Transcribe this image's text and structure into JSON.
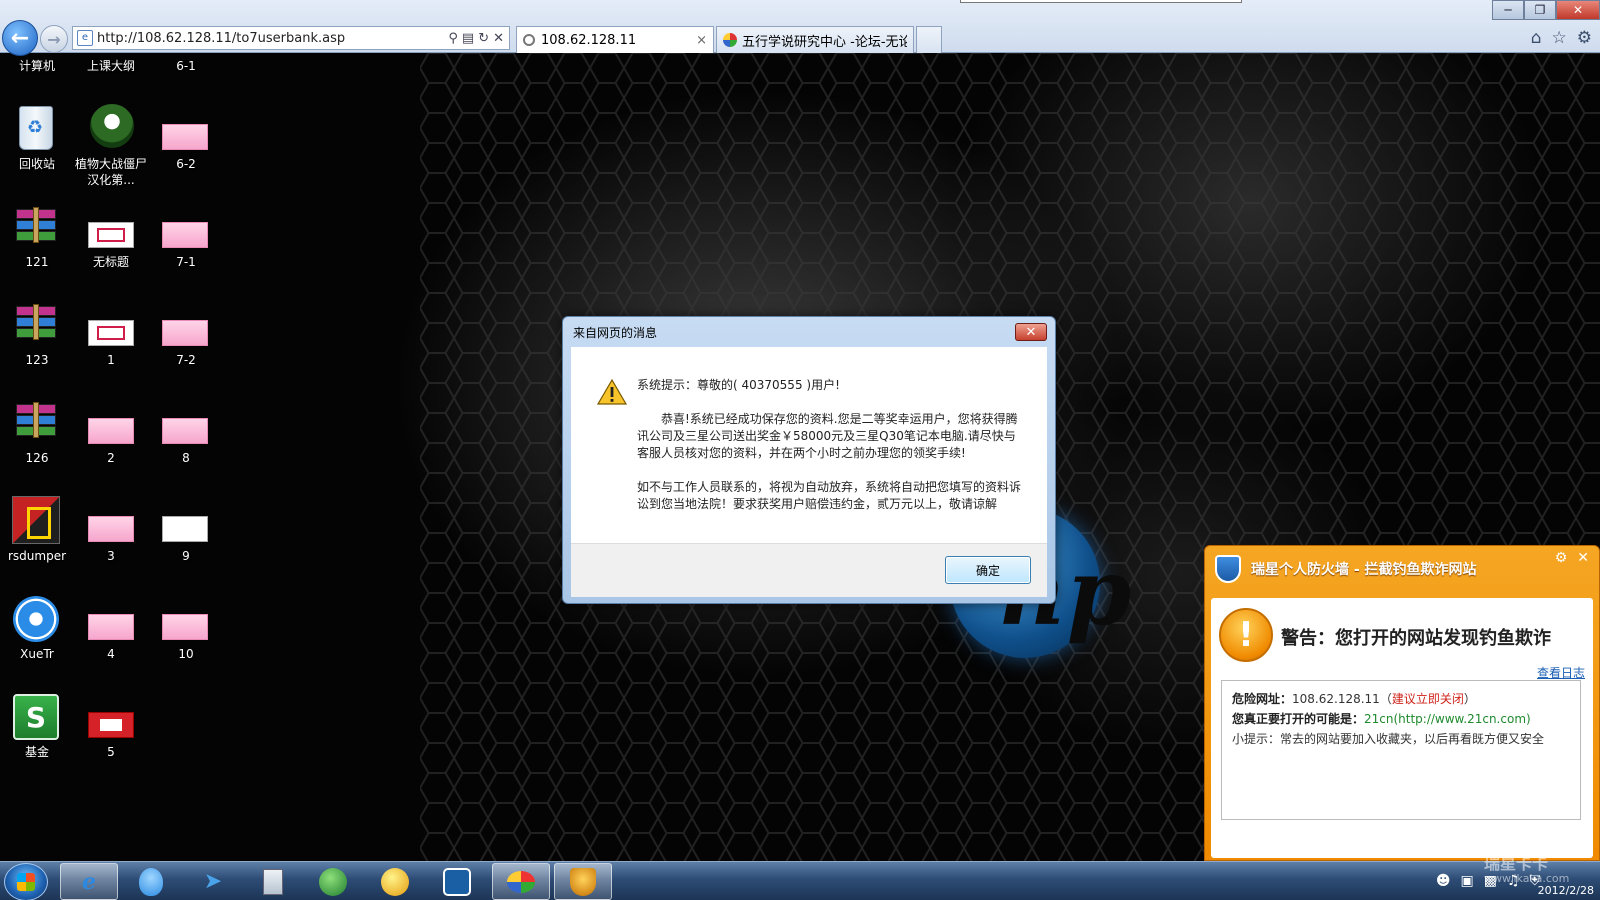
{
  "browser": {
    "url": "http://108.62.128.11/to7userbank.asp",
    "tabs": [
      {
        "title": "108.62.128.11"
      },
      {
        "title": "五行学说研究中心 -论坛-无论..."
      }
    ],
    "tab_close": "×",
    "icons": [
      "back-arrow-icon",
      "forward-arrow-icon",
      "search-icon",
      "refresh-icon",
      "stop-icon",
      "home-icon",
      "favorites-star-icon",
      "tools-gear-icon"
    ]
  },
  "desktop": {
    "icons": [
      {
        "label": "计算机"
      },
      {
        "label": "上课大纲"
      },
      {
        "label": "6-1"
      },
      {
        "label": "回收站"
      },
      {
        "label": "植物大战僵尸 汉化第..."
      },
      {
        "label": "6-2"
      },
      {
        "label": "121"
      },
      {
        "label": "无标题"
      },
      {
        "label": "7-1"
      },
      {
        "label": "123"
      },
      {
        "label": "1"
      },
      {
        "label": "7-2"
      },
      {
        "label": "126"
      },
      {
        "label": "2"
      },
      {
        "label": "8"
      },
      {
        "label": "rsdumper"
      },
      {
        "label": "3"
      },
      {
        "label": "9"
      },
      {
        "label": "XueTr"
      },
      {
        "label": "4"
      },
      {
        "label": "10"
      },
      {
        "label": "基金"
      },
      {
        "label": "5"
      }
    ]
  },
  "dialog": {
    "title": "来自网页的消息",
    "close": "✕",
    "line1": "系统提示：尊敬的( 40370555 )用户!",
    "para2": "恭喜!系统已经成功保存您的资料.您是二等奖幸运用户，您将获得腾讯公司及三星公司送出奖金￥58000元及三星Q30笔记本电脑.请尽快与客服人员核对您的资料，并在两个小时之前办理您的领奖手续!",
    "para3": "如不与工作人员联系的，将视为自动放弃，系统将自动把您填写的资料诉讼到您当地法院！要求获奖用户赔偿违约金，贰万元以上，敬请谅解",
    "ok": "确定"
  },
  "firewall": {
    "title": "瑞星个人防火墙 - 拦截钓鱼欺诈网站",
    "heading": "警告：您打开的网站发现钓鱼欺诈",
    "log_link": "查看日志",
    "danger_label": "危险网址：",
    "danger_url": "108.62.128.11",
    "danger_paren_open": "（",
    "danger_action": "建议立即关闭",
    "danger_paren_close": "）",
    "real_label": "您真正要打开的可能是：",
    "real_site": "21cn(http://www.21cn.com)",
    "tip": "小提示：常去的网站要加入收藏夹，以后再看既方便又安全"
  },
  "taskbar": {
    "date": "2012/2/28",
    "watermark": "瑞星卡卡",
    "watermark_url": "www.ikaka.com"
  }
}
